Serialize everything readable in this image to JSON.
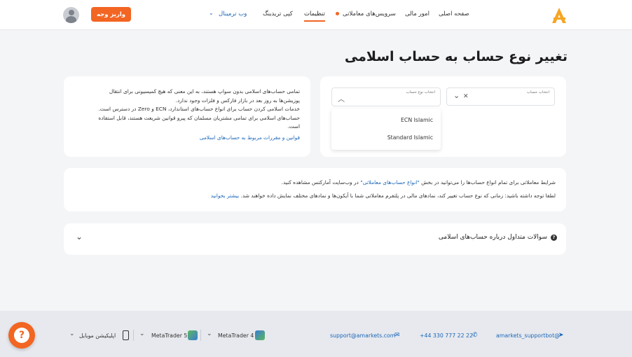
{
  "header": {
    "nav": [
      "صفحه اصلی",
      "امور مالی",
      "سرویس‌های معاملاتی",
      "تنظیمات",
      "کپی تریدینگ",
      "وب ترمینال"
    ],
    "deposit_label": "واریز وجه"
  },
  "page": {
    "title": "تغییر نوع حساب به حساب اسلامی"
  },
  "form": {
    "account_select_label": "انتخاب حساب",
    "account_type_label": "انتخاب نوع حساب",
    "options": [
      "ECN Islamic",
      "Standard Islamic"
    ]
  },
  "info_card": {
    "lines": [
      "تمامی حساب‌های اسلامی بدون سواپ هستند، به این معنی که هیچ کمیسیونی برای انتقال",
      "پوزیشن‌ها به روز بعد در بازار فارکس و فلزات وجود ندارد.",
      "خدمات اسلامی کردن حساب برای انواع حساب‌های استاندارد، ECN و Zero در دسترس است.",
      "حساب‌های اسلامی برای تمامی مشتریان مسلمان که پیرو قوانین شریعت هستند، قابل استفاده",
      "است."
    ],
    "link": "قوانین و مقررات مربوط به حساب‌های اسلامی"
  },
  "notice": {
    "line1_before": "شرایط معاملاتی برای تمام انواع حساب‌ها را می‌توانید در بخش ",
    "line1_link": "\"انواع حساب‌های معاملاتی\"",
    "line1_after": " در وب‌سایت آمارکتس مشاهده کنید.",
    "line2": "لطفا توجه داشته باشید: زمانی که نوع حساب تغییر کند، نمادهای مالی در پلتفرم معاملاتی شما با آیکون‌ها و نمادهای مختلف نمایش داده خواهند شد.",
    "line2_link": "بیشتر بخوانید"
  },
  "faq": {
    "title": "سوالات متداول درباره حساب‌های اسلامی"
  },
  "footer": {
    "telegram": "amarkets_supportbot@",
    "phone": "+44 330 777 22 22",
    "email": "support@amarkets.com",
    "mt4": "MetaTrader 4",
    "mt5": "MetaTrader 5",
    "mobile": "اپلیکیشن موبایل"
  },
  "colors": {
    "accent": "#f26522",
    "link": "#1a66b8",
    "logo": "#f5a623"
  }
}
